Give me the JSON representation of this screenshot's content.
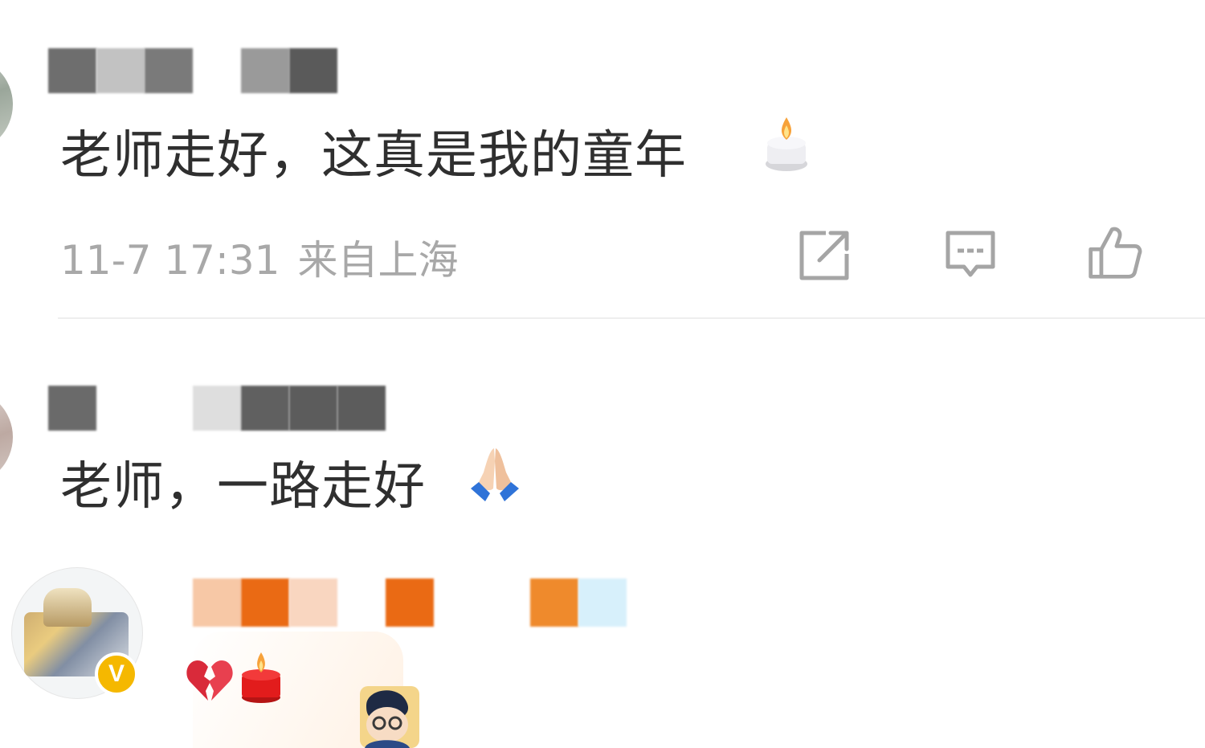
{
  "comments": [
    {
      "username_hidden": true,
      "text": "老师走好，这真是我的童年",
      "emoji": "candle",
      "time": "11-7 17:31",
      "location": "来自上海"
    },
    {
      "username_hidden": true,
      "text": "老师，一路走好",
      "emoji": "folded-hands"
    },
    {
      "username_hidden": true,
      "verified_badge": "V",
      "emojis": [
        "broken-heart",
        "red-candle"
      ]
    }
  ],
  "actions": {
    "share_icon": "share-icon",
    "reply_icon": "comment-icon",
    "like_icon": "thumbs-up-icon"
  },
  "colors": {
    "meta_text": "#a8a8a8",
    "comment_text": "#2f2f2f",
    "badge": "#f5b800",
    "divider": "#eeeeee"
  }
}
